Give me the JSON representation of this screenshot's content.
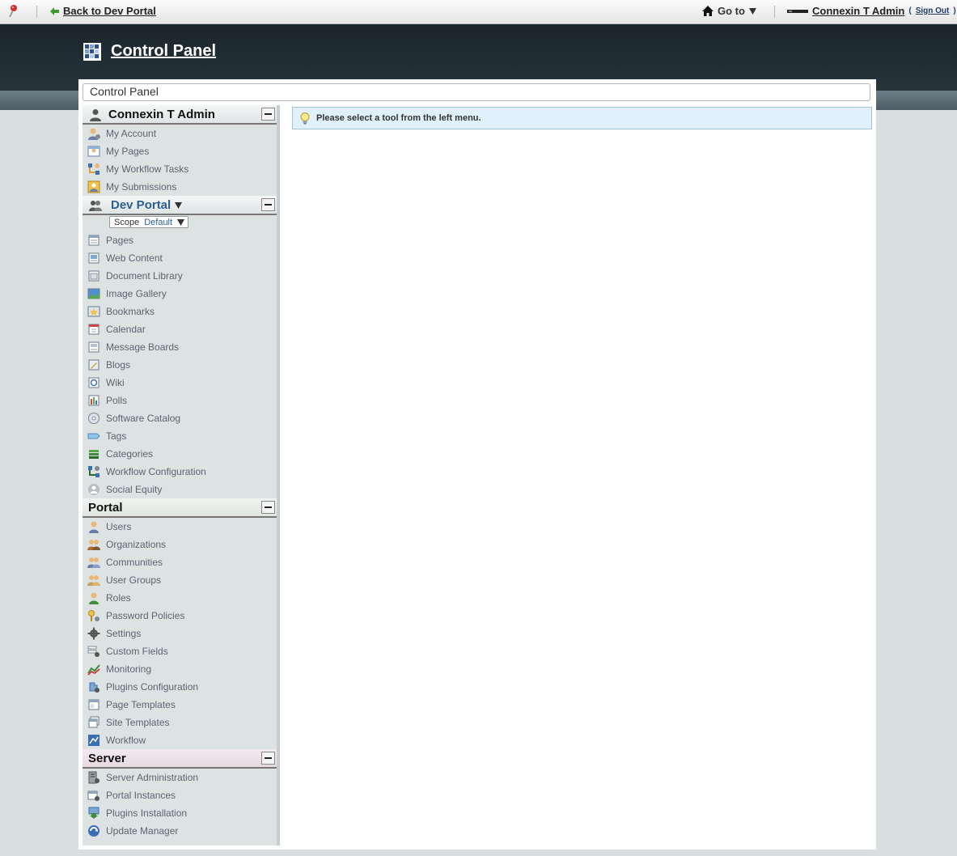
{
  "dockbar": {
    "back_label": "Back to Dev Portal",
    "goto_label": "Go to",
    "user_name": "Connexin T Admin",
    "sign_out_open": "(",
    "sign_out_label": "Sign Out",
    "sign_out_close": ")"
  },
  "header": {
    "title": "Control Panel"
  },
  "breadcrumb": {
    "text": "Control Panel"
  },
  "menu": {
    "user_panel": {
      "title": "Connexin T Admin",
      "items": [
        "My Account",
        "My Pages",
        "My Workflow Tasks",
        "My Submissions"
      ]
    },
    "community_panel": {
      "title": "Dev Portal",
      "scope_label": "Scope",
      "scope_value": "Default",
      "items": [
        "Pages",
        "Web Content",
        "Document Library",
        "Image Gallery",
        "Bookmarks",
        "Calendar",
        "Message Boards",
        "Blogs",
        "Wiki",
        "Polls",
        "Software Catalog",
        "Tags",
        "Categories",
        "Workflow Configuration",
        "Social Equity"
      ]
    },
    "portal_panel": {
      "title": "Portal",
      "items": [
        "Users",
        "Organizations",
        "Communities",
        "User Groups",
        "Roles",
        "Password Policies",
        "Settings",
        "Custom Fields",
        "Monitoring",
        "Plugins Configuration",
        "Page Templates",
        "Site Templates",
        "Workflow"
      ]
    },
    "server_panel": {
      "title": "Server",
      "items": [
        "Server Administration",
        "Portal Instances",
        "Plugins Installation",
        "Update Manager"
      ]
    }
  },
  "content": {
    "info_message": "Please select a tool from the left menu."
  },
  "colors": {
    "header_bg": "#1b252c",
    "menu_bg": "#dde2e3",
    "info_bg": "#e0f1fb",
    "link": "#2b5f91"
  }
}
